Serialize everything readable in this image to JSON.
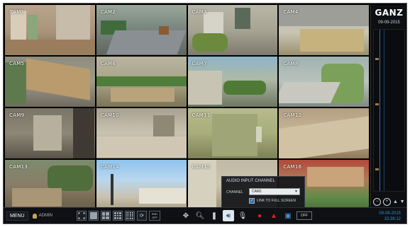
{
  "cameras": [
    {
      "label": "CAM1"
    },
    {
      "label": "CAM2"
    },
    {
      "label": "CAM3"
    },
    {
      "label": "CAM4"
    },
    {
      "label": "CAM5"
    },
    {
      "label": "CAM6"
    },
    {
      "label": "CAM7"
    },
    {
      "label": "CAM8"
    },
    {
      "label": "CAM9"
    },
    {
      "label": "CAM10"
    },
    {
      "label": "CAM11"
    },
    {
      "label": "CAM12"
    },
    {
      "label": "CAM13"
    },
    {
      "label": "CAM14"
    },
    {
      "label": "CAM15"
    },
    {
      "label": "CAM16"
    }
  ],
  "side": {
    "logo": "GANZ",
    "date": "09-09-2015"
  },
  "toolbar": {
    "menu_label": "MENU",
    "user_label": "ADMIN",
    "end_off_label": "END OFF",
    "off_label": "OFF",
    "clock_date": "09-09-2015",
    "clock_time": "15:36:12"
  },
  "popup": {
    "title": "AUDIO INPUT CHANNEL",
    "channel_label": "CHANNEL",
    "channel_value": "CAM1",
    "link_label": "LINK TO FULL SCREEN",
    "link_checked": true
  },
  "icons": {
    "menu": "menu-button",
    "user": "user-icon",
    "fullscreen": "fullscreen-icon",
    "layout1": "layout-1-icon",
    "layout4": "layout-4-icon",
    "layout9": "layout-9-icon",
    "layout16": "layout-16-icon",
    "sequence": "sequence-icon",
    "ptz": "ptz-icon",
    "zoom": "zoom-icon",
    "freeze": "freeze-icon",
    "audio": "audio-icon",
    "mic": "mic-icon",
    "record": "record-icon",
    "alarm": "alarm-icon",
    "network": "network-icon"
  },
  "colors": {
    "accent": "#2f8fd9",
    "record": "#e02020"
  }
}
